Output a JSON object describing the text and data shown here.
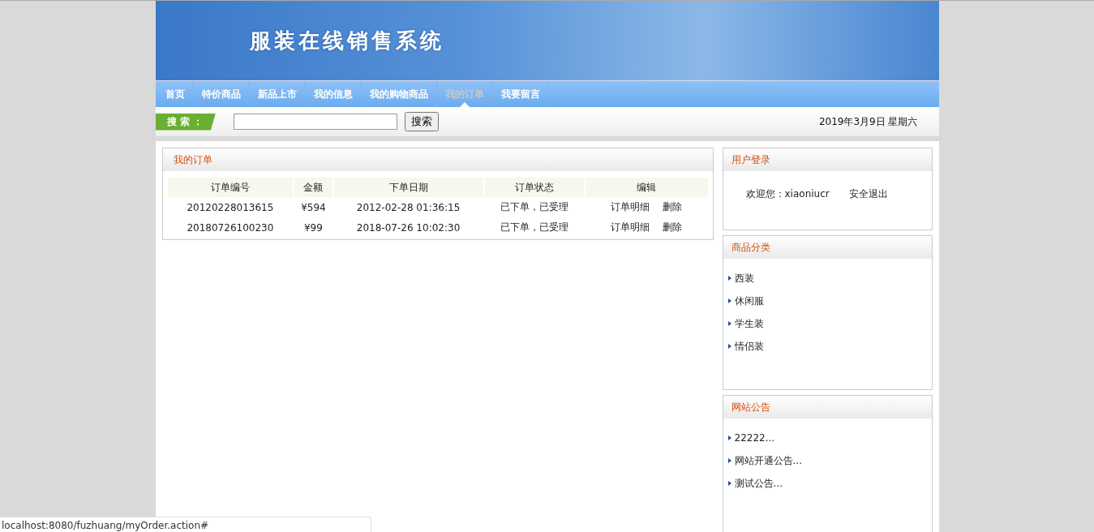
{
  "banner": {
    "title": "服装在线销售系统"
  },
  "nav": [
    {
      "label": "首页",
      "selected": false
    },
    {
      "label": "特价商品",
      "selected": false
    },
    {
      "label": "新品上市",
      "selected": false
    },
    {
      "label": "我的信息",
      "selected": false
    },
    {
      "label": "我的购物商品",
      "selected": false
    },
    {
      "label": "我的订单",
      "selected": true
    },
    {
      "label": "我要留言",
      "selected": false
    }
  ],
  "search": {
    "label": "搜 索 ：",
    "button": "搜索",
    "date": "2019年3月9日 星期六"
  },
  "orders": {
    "title": "我的订单",
    "columns": [
      "订单编号",
      "金额",
      "下单日期",
      "订单状态",
      "编辑"
    ],
    "rows": [
      {
        "id": "20120228013615",
        "amount": "¥594",
        "date": "2012-02-28 01:36:15",
        "status": "已下单，已受理",
        "actions": [
          "订单明细",
          "删除"
        ]
      },
      {
        "id": "20180726100230",
        "amount": "¥99",
        "date": "2018-07-26 10:02:30",
        "status": "已下单，已受理",
        "actions": [
          "订单明细",
          "删除"
        ]
      }
    ]
  },
  "login": {
    "title": "用户登录",
    "welcome": "欢迎您：xiaoniucr",
    "logout": "安全退出"
  },
  "categories": {
    "title": "商品分类",
    "items": [
      "西装",
      "休闲服",
      "学生装",
      "情侣装"
    ]
  },
  "notices": {
    "title": "网站公告",
    "items": [
      "22222...",
      "网站开通公告...",
      "测试公告..."
    ]
  },
  "status_bar": "localhost:8080/fuzhuang/myOrder.action#"
}
